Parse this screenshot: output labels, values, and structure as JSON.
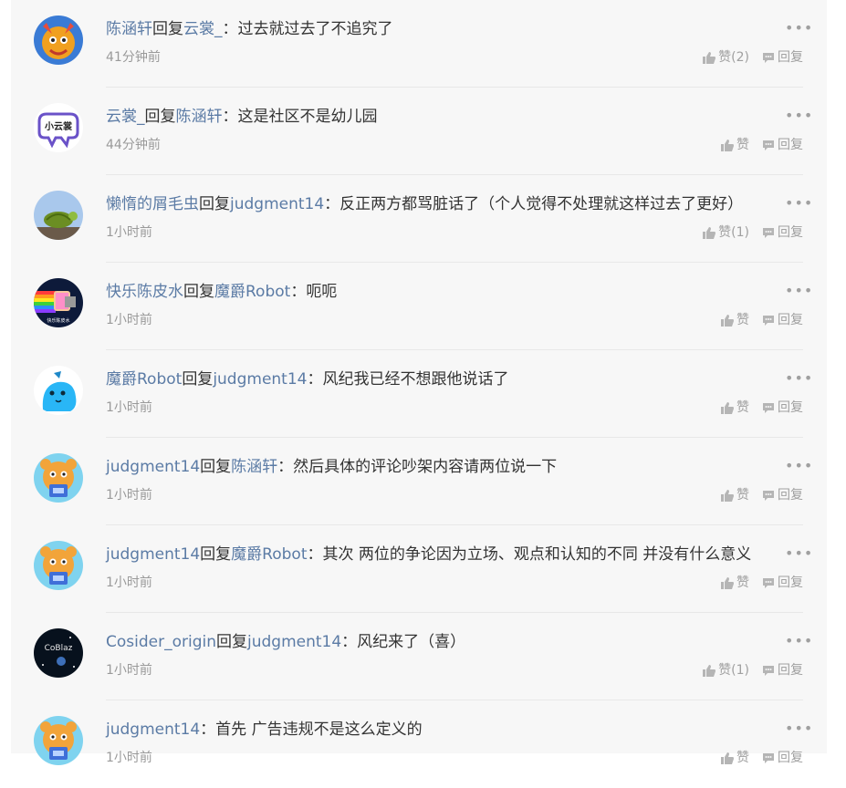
{
  "comments": [
    {
      "user": "陈涵轩",
      "reply_word": "回复",
      "target": "云裳_",
      "sep": "：",
      "text": "过去就过去了不追究了",
      "time": "41分钟前",
      "like": "赞(2)",
      "reply": "回复",
      "more": "•••",
      "avatar": "orange"
    },
    {
      "user": "云裳_",
      "reply_word": "回复",
      "target": "陈涵轩",
      "sep": "：",
      "text": "这是社区不是幼儿园",
      "time": "44分钟前",
      "like": "赞",
      "reply": "回复",
      "more": "•••",
      "avatar": "cloud"
    },
    {
      "user": "懒惰的屑毛虫",
      "reply_word": "回复",
      "target": "judgment14",
      "sep": "：",
      "text": "反正两方都骂脏话了（个人觉得不处理就这样过去了更好）",
      "time": "1小时前",
      "like": "赞(1)",
      "reply": "回复",
      "more": "•••",
      "avatar": "turtle"
    },
    {
      "user": "快乐陈皮水",
      "reply_word": "回复",
      "target": "魔爵Robot",
      "sep": "：",
      "text": "呃呃",
      "time": "1小时前",
      "like": "赞",
      "reply": "回复",
      "more": "•••",
      "avatar": "nyan"
    },
    {
      "user": "魔爵Robot",
      "reply_word": "回复",
      "target": "judgment14",
      "sep": "：",
      "text": "风纪我已经不想跟他说话了",
      "time": "1小时前",
      "like": "赞",
      "reply": "回复",
      "more": "•••",
      "avatar": "blue"
    },
    {
      "user": "judgment14",
      "reply_word": "回复",
      "target": "陈涵轩",
      "sep": "：",
      "text": "然后具体的评论吵架内容请两位说一下",
      "time": "1小时前",
      "like": "赞",
      "reply": "回复",
      "more": "•••",
      "avatar": "robot"
    },
    {
      "user": "judgment14",
      "reply_word": "回复",
      "target": "魔爵Robot",
      "sep": "：",
      "text": "其次 两位的争论因为立场、观点和认知的不同 并没有什么意义",
      "time": "1小时前",
      "like": "赞",
      "reply": "回复",
      "more": "•••",
      "avatar": "robot"
    },
    {
      "user": "Cosider_origin",
      "reply_word": "回复",
      "target": "judgment14",
      "sep": "：",
      "text": "风纪来了（喜）",
      "time": "1小时前",
      "like": "赞(1)",
      "reply": "回复",
      "more": "•••",
      "avatar": "dark"
    },
    {
      "user": "judgment14",
      "reply_word": "",
      "target": "",
      "sep": "：",
      "text": "首先 广告违规不是这么定义的",
      "time": "1小时前",
      "like": "赞",
      "reply": "回复",
      "more": "•••",
      "avatar": "robot"
    }
  ],
  "avatar_labels": {
    "cloud": "小云裳",
    "nyan": "快乐陈皮水",
    "dark": "CoBlaz"
  },
  "colors": {
    "username": "#5b7ba5",
    "text": "#333333",
    "meta": "#9a9a9a",
    "background": "#f7f7f7",
    "divider": "#e8e8e8"
  },
  "icons": {
    "like": "thumbs-up-icon",
    "reply": "chat-bubble-icon",
    "more": "more-dots-icon"
  }
}
